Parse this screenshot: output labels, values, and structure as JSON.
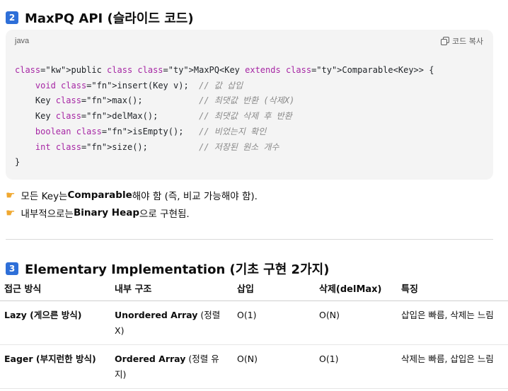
{
  "section2": {
    "badge": "2",
    "title": "MaxPQ API (슬라이드 코드)"
  },
  "code_block": {
    "language": "java",
    "copy_label": "코드 복사",
    "lines": [
      "public class MaxPQ<Key extends Comparable<Key>> {",
      "    void insert(Key v);  // 값 삽입",
      "    Key max();           // 최댓값 반환 (삭제X)",
      "    Key delMax();        // 최댓값 삭제 후 반환",
      "    boolean isEmpty();   // 비었는지 확인",
      "    int size();          // 저장된 원소 개수",
      "}"
    ]
  },
  "bullets": [
    {
      "pre": "모든 Key는 ",
      "bold": "Comparable",
      "post": " 해야 함 (즉, 비교 가능해야 함)."
    },
    {
      "pre": "내부적으로는 ",
      "bold": "Binary Heap",
      "post": " 으로 구현됨."
    }
  ],
  "section3": {
    "badge": "3",
    "title": "Elementary Implementation (기초 구현 2가지)"
  },
  "table": {
    "headers": [
      "접근 방식",
      "내부 구조",
      "삽입",
      "삭제(delMax)",
      "특징"
    ],
    "rows": [
      {
        "approach": "Lazy (게으른 방식)",
        "structure_bold": "Unordered Array",
        "structure_rest": " (정렬 X)",
        "insert": "O(1)",
        "delete": "O(N)",
        "feature": "삽입은 빠름, 삭제는 느림"
      },
      {
        "approach": "Eager (부지런한 방식)",
        "structure_bold": "Ordered Array",
        "structure_rest": " (정렬 유지)",
        "insert": "O(N)",
        "delete": "O(1)",
        "feature": "삭제는 빠름, 삽입은 느림"
      }
    ]
  }
}
